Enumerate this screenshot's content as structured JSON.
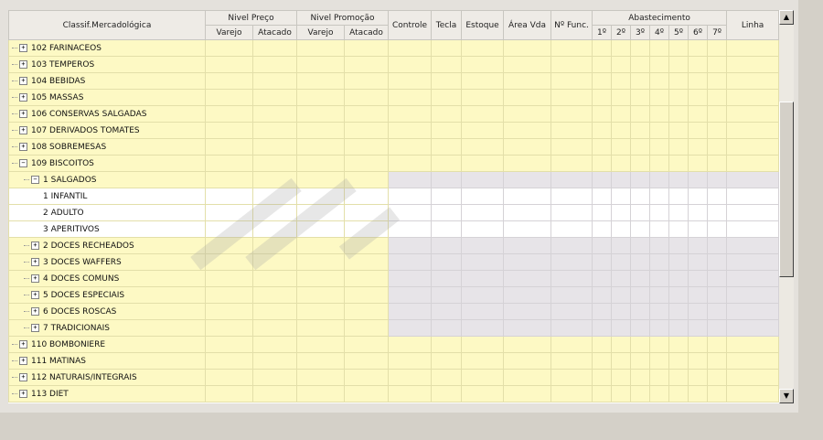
{
  "headers": {
    "classif": "Classif.Mercadológica",
    "nivel_preco": "Nivel Preço",
    "nivel_promocao": "Nivel Promoção",
    "varejo": "Varejo",
    "atacado": "Atacado",
    "controle": "Controle",
    "tecla": "Tecla",
    "estoque": "Estoque",
    "area_vda": "Área Vda",
    "n_func": "Nº Func.",
    "abastecimento": "Abastecimento",
    "days": [
      "1º",
      "2º",
      "3º",
      "4º",
      "5º",
      "6º",
      "7º"
    ],
    "linha": "Linha"
  },
  "rows": [
    {
      "label": "102 FARINACEOS",
      "level": 0,
      "expander": "+",
      "style": "yellow"
    },
    {
      "label": "103 TEMPEROS",
      "level": 0,
      "expander": "+",
      "style": "yellow"
    },
    {
      "label": "104 BEBIDAS",
      "level": 0,
      "expander": "+",
      "style": "yellow"
    },
    {
      "label": "105 MASSAS",
      "level": 0,
      "expander": "+",
      "style": "yellow"
    },
    {
      "label": "106 CONSERVAS SALGADAS",
      "level": 0,
      "expander": "+",
      "style": "yellow"
    },
    {
      "label": "107 DERIVADOS TOMATES",
      "level": 0,
      "expander": "+",
      "style": "yellow"
    },
    {
      "label": "108 SOBREMESAS",
      "level": 0,
      "expander": "+",
      "style": "yellow"
    },
    {
      "label": "109 BISCOITOS",
      "level": 0,
      "expander": "−",
      "style": "yellow"
    },
    {
      "label": "1 SALGADOS",
      "level": 1,
      "expander": "−",
      "style": "yellow-gray"
    },
    {
      "label": "1 INFANTIL",
      "level": 2,
      "expander": "",
      "style": "white"
    },
    {
      "label": "2 ADULTO",
      "level": 2,
      "expander": "",
      "style": "white"
    },
    {
      "label": "3 APERITIVOS",
      "level": 2,
      "expander": "",
      "style": "white"
    },
    {
      "label": "2 DOCES RECHEADOS",
      "level": 1,
      "expander": "+",
      "style": "yellow-gray"
    },
    {
      "label": "3 DOCES WAFFERS",
      "level": 1,
      "expander": "+",
      "style": "yellow-gray"
    },
    {
      "label": "4 DOCES COMUNS",
      "level": 1,
      "expander": "+",
      "style": "yellow-gray"
    },
    {
      "label": "5 DOCES ESPECIAIS",
      "level": 1,
      "expander": "+",
      "style": "yellow-gray"
    },
    {
      "label": "6 DOCES ROSCAS",
      "level": 1,
      "expander": "+",
      "style": "yellow-gray"
    },
    {
      "label": "7 TRADICIONAIS",
      "level": 1,
      "expander": "+",
      "style": "yellow-gray"
    },
    {
      "label": "110 BOMBONIERE",
      "level": 0,
      "expander": "+",
      "style": "yellow"
    },
    {
      "label": "111 MATINAS",
      "level": 0,
      "expander": "+",
      "style": "yellow"
    },
    {
      "label": "112 NATURAIS/INTEGRAIS",
      "level": 0,
      "expander": "+",
      "style": "yellow"
    },
    {
      "label": "113 DIET",
      "level": 0,
      "expander": "+",
      "style": "yellow"
    }
  ],
  "icons": {
    "scroll_up": "arrow-up-icon",
    "scroll_down": "arrow-down-icon"
  }
}
